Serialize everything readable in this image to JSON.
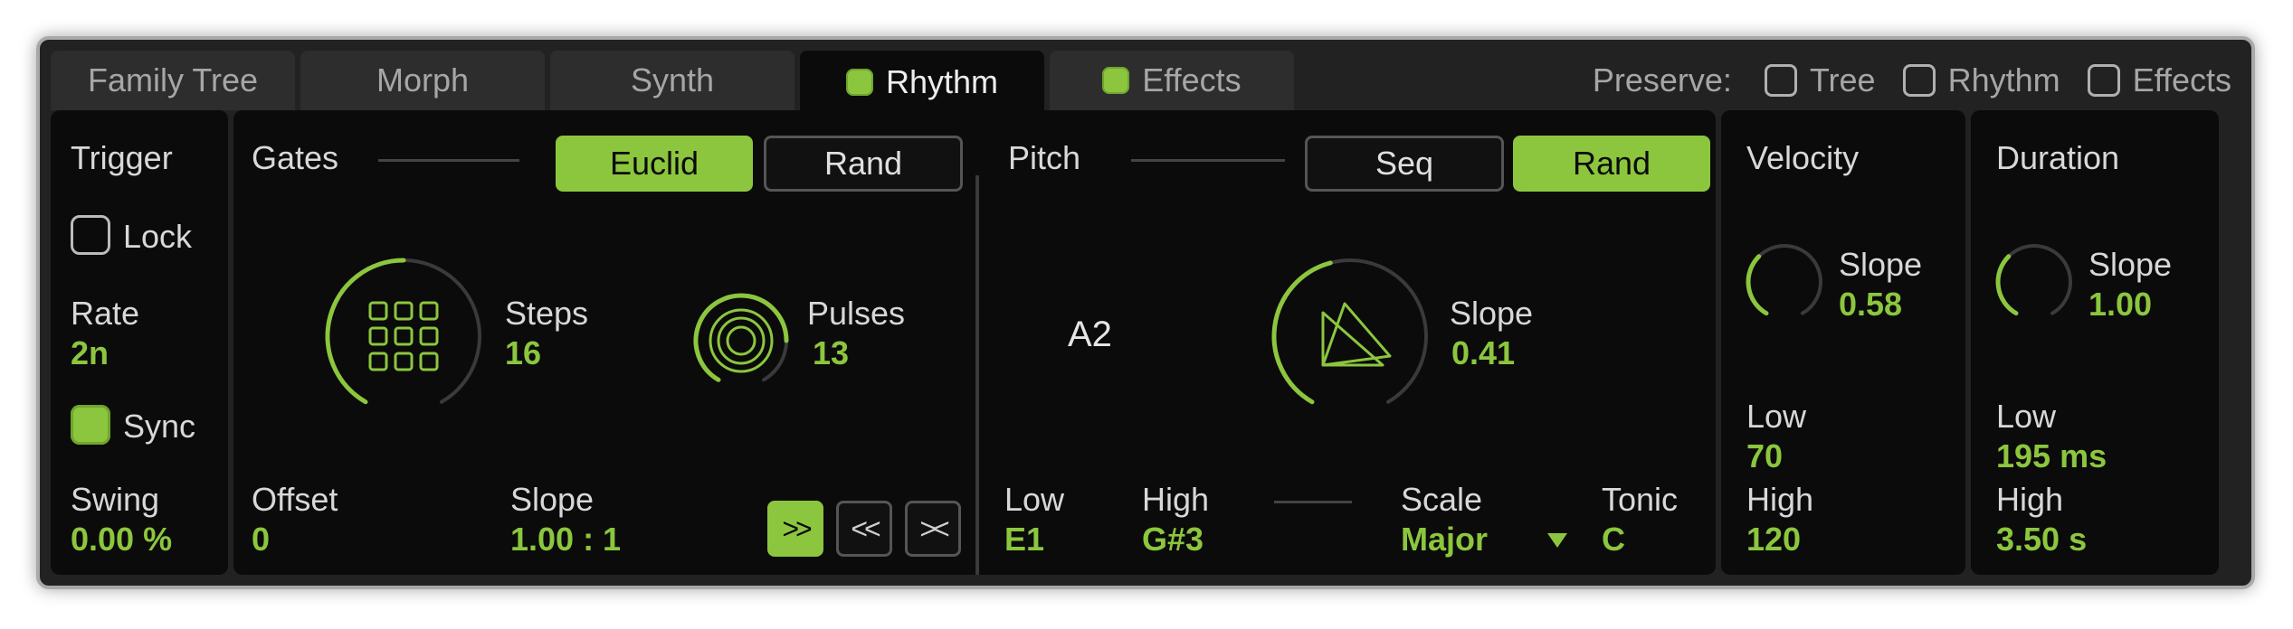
{
  "tabs": [
    {
      "label": "Family Tree",
      "led": false,
      "active": false
    },
    {
      "label": "Morph",
      "led": false,
      "active": false
    },
    {
      "label": "Synth",
      "led": false,
      "active": false
    },
    {
      "label": "Rhythm",
      "led": true,
      "active": true
    },
    {
      "label": "Effects",
      "led": true,
      "active": false
    }
  ],
  "preserve": {
    "label": "Preserve:",
    "items": [
      {
        "label": "Tree",
        "checked": false
      },
      {
        "label": "Rhythm",
        "checked": false
      },
      {
        "label": "Effects",
        "checked": false
      }
    ]
  },
  "trigger": {
    "title": "Trigger",
    "lock_label": "Lock",
    "lock_checked": false,
    "rate_label": "Rate",
    "rate_value": "2n",
    "sync_label": "Sync",
    "sync_on": true,
    "swing_label": "Swing",
    "swing_value": "0.00 %"
  },
  "gates": {
    "title": "Gates",
    "mode_buttons": [
      {
        "label": "Euclid",
        "on": true
      },
      {
        "label": "Rand",
        "on": false
      }
    ],
    "steps_label": "Steps",
    "steps_value": "16",
    "steps_level": 0.5,
    "pulses_label": "Pulses",
    "pulses_value": "13",
    "pulses_level": 0.8,
    "offset_label": "Offset",
    "offset_value": "0",
    "slope_label": "Slope",
    "slope_value": "1.00 : 1",
    "direction_buttons": [
      {
        "glyph": ">>",
        "on": true
      },
      {
        "glyph": "<<",
        "on": false
      },
      {
        "glyph": "><",
        "on": false
      }
    ]
  },
  "pitch": {
    "title": "Pitch",
    "mode_buttons": [
      {
        "label": "Seq",
        "on": false
      },
      {
        "label": "Rand",
        "on": true
      }
    ],
    "note_display": "A2",
    "slope_label": "Slope",
    "slope_value": "0.41",
    "slope_level": 0.45,
    "low_label": "Low",
    "low_value": "E1",
    "high_label": "High",
    "high_value": "G#3",
    "scale_label": "Scale",
    "scale_value": "Major",
    "tonic_label": "Tonic",
    "tonic_value": "C"
  },
  "velocity": {
    "title": "Velocity",
    "slope_label": "Slope",
    "slope_value": "0.58",
    "slope_level": 0.35,
    "low_label": "Low",
    "low_value": "70",
    "high_label": "High",
    "high_value": "120"
  },
  "duration": {
    "title": "Duration",
    "slope_label": "Slope",
    "slope_value": "1.00",
    "slope_level": 0.35,
    "low_label": "Low",
    "low_value": "195 ms",
    "high_label": "High",
    "high_value": "3.50 s"
  },
  "colors": {
    "accent": "#8cc63e",
    "panel": "#0b0b0b",
    "frame": "#222222",
    "tab": "#2d2d2d",
    "knob_track": "#3a3a3a"
  }
}
